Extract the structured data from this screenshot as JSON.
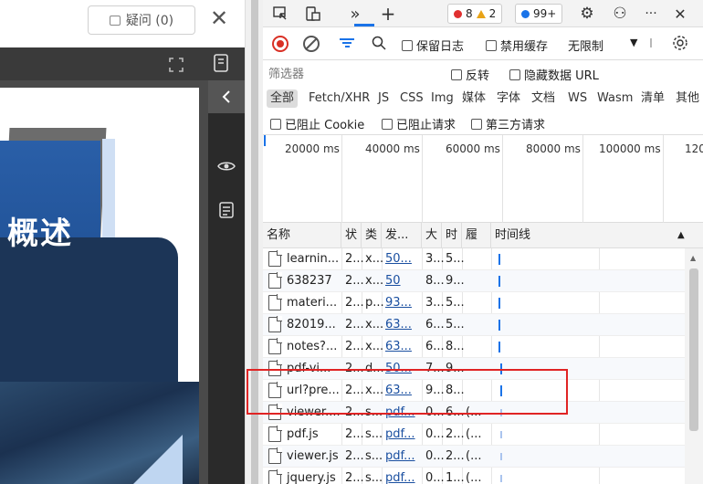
{
  "left": {
    "doubt_button": "疑问 (0)",
    "close": "✕",
    "slide_title": "概述"
  },
  "devtools": {
    "toolbar": {
      "inspect": "⬚",
      "device": "▢",
      "more_tabs": "»",
      "add_tab": "+",
      "errors": "8",
      "warnings": "2",
      "issues": "99+",
      "settings": "⚙",
      "profile": "⚇",
      "more": "···",
      "close": "✕"
    },
    "network_bar": {
      "preserve_log": "保留日志",
      "disable_cache": "禁用缓存",
      "throttle": "无限制",
      "throttle_arrow": "▼"
    },
    "filter": {
      "placeholder": "筛选器",
      "invert": "反转",
      "hide_data_urls": "隐藏数据 URL"
    },
    "types": [
      "全部",
      "Fetch/XHR",
      "JS",
      "CSS",
      "Img",
      "媒体",
      "字体",
      "文档",
      "WS",
      "Wasm",
      "清单",
      "其他"
    ],
    "blocked": {
      "blocked_cookies": "已阻止 Cookie",
      "blocked_requests": "已阻止请求",
      "third_party": "第三方请求"
    },
    "overview_ticks": [
      "20000 ms",
      "40000 ms",
      "60000 ms",
      "80000 ms",
      "100000 ms",
      "120"
    ],
    "table": {
      "headers": [
        "名称",
        "状",
        "类",
        "发...",
        "大",
        "时",
        "履",
        "时间线"
      ],
      "sort_arrow": "▲",
      "rows": [
        {
          "name": "learnin...",
          "status": "2...",
          "type": "x...",
          "initiator": "50...",
          "size": "3...",
          "time": "5...",
          "extra": ""
        },
        {
          "name": "638237",
          "status": "2...",
          "type": "x...",
          "initiator": "50",
          "size": "8...",
          "time": "9...",
          "extra": ""
        },
        {
          "name": "materi...",
          "status": "2...",
          "type": "p...",
          "initiator": "93...",
          "size": "3...",
          "time": "5...",
          "extra": ""
        },
        {
          "name": "82019...",
          "status": "2...",
          "type": "x...",
          "initiator": "63...",
          "size": "6...",
          "time": "5...",
          "extra": ""
        },
        {
          "name": "notes?...",
          "status": "2...",
          "type": "x...",
          "initiator": "63...",
          "size": "6...",
          "time": "8...",
          "extra": ""
        },
        {
          "name": "pdf-vi...",
          "status": "2...",
          "type": "d...",
          "initiator": "50...",
          "size": "7...",
          "time": "9...",
          "extra": ""
        },
        {
          "name": "url?pre...",
          "status": "2...",
          "type": "x...",
          "initiator": "63...",
          "size": "9...",
          "time": "8...",
          "extra": ""
        },
        {
          "name": "viewer....",
          "status": "2...",
          "type": "s...",
          "initiator": "pdf...",
          "size": "0...",
          "time": "6...",
          "extra": "(..."
        },
        {
          "name": "pdf.js",
          "status": "2...",
          "type": "s...",
          "initiator": "pdf...",
          "size": "0...",
          "time": "2...",
          "extra": "(..."
        },
        {
          "name": "viewer.js",
          "status": "2...",
          "type": "s...",
          "initiator": "pdf...",
          "size": "0...",
          "time": "2...",
          "extra": "(..."
        },
        {
          "name": "jquery.js",
          "status": "2...",
          "type": "s...",
          "initiator": "pdf...",
          "size": "0...",
          "time": "1...",
          "extra": "(..."
        }
      ]
    }
  },
  "colors": {
    "accent": "#1a73e8",
    "error": "#e03030",
    "warning": "#e8a317",
    "highlight": "#e02424",
    "slide_navy": "#1c3557"
  }
}
